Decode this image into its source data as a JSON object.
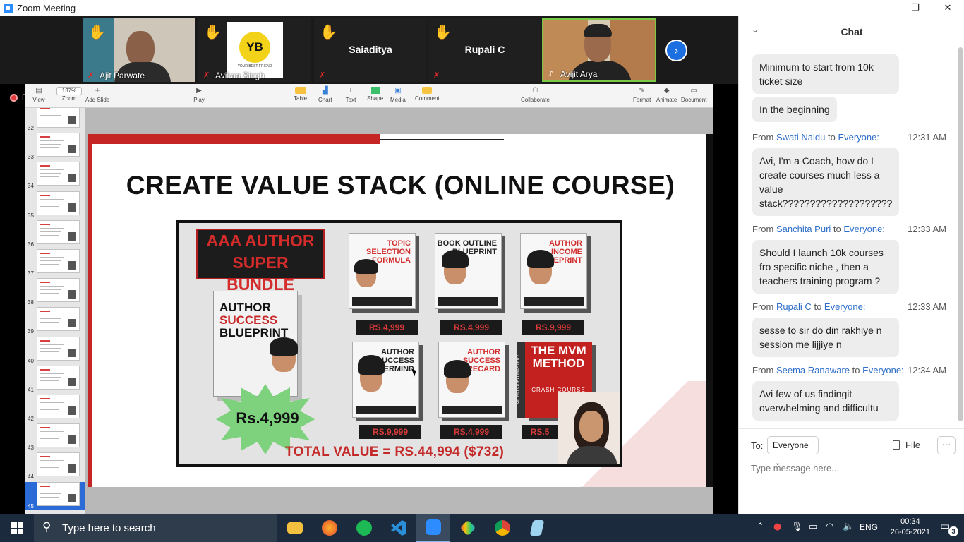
{
  "window": {
    "title": "Zoom Meeting",
    "min": "—",
    "max": "❐",
    "close": "✕"
  },
  "participants": [
    {
      "name": "Ajit Parwate"
    },
    {
      "name": "Avikaa Singh",
      "logo_text": "YB",
      "logo_caption": "YOUR BEST FRIEND"
    },
    {
      "name": "Saiaditya"
    },
    {
      "name": "Rupali C"
    },
    {
      "name": "Avijit Arya"
    }
  ],
  "share": {
    "rec_label": "R",
    "toolbar": {
      "view": "View",
      "zoom": "Zoom",
      "zoom_value": "137%",
      "add_slide": "Add Slide",
      "play": "Play",
      "table": "Table",
      "chart": "Chart",
      "text": "Text",
      "shape": "Shape",
      "media": "Media",
      "comment": "Comment",
      "collaborate": "Collaborate",
      "format": "Format",
      "animate": "Animate",
      "document": "Document"
    },
    "slides": [
      "32",
      "33",
      "34",
      "35",
      "36",
      "37",
      "38",
      "39",
      "40",
      "41",
      "42",
      "43",
      "44",
      "45"
    ],
    "slide": {
      "title": "CREATE VALUE STACK (ONLINE COURSE)",
      "bundle_line1": "AAA AUTHOR",
      "bundle_line2": "SUPER BUNDLE",
      "main_product": [
        "AUTHOR",
        "SUCCESS",
        "BLUEPRINT"
      ],
      "main_price": "Rs.4,999",
      "products": [
        {
          "title": "TOPIC SELECTION FORMULA"
        },
        {
          "title": "BOOK OUTLINE BLUEPRINT"
        },
        {
          "title": "AUTHOR INCOME BLUEPRINT"
        },
        {
          "title": "AUTHOR SUCCESS MASTERMIND"
        },
        {
          "title": "AUTHOR SUCCESS SCORECARD"
        }
      ],
      "mvm": {
        "line1": "THE MVM METHOD",
        "line2": "CRASH COURSE",
        "side": "MICRO VIDEO MASTERY"
      },
      "prices_row1": [
        "RS.4,999",
        "RS.4,999",
        "RS.9,999"
      ],
      "prices_row2": [
        "RS.9,999",
        "RS.4,999",
        "RS.5"
      ],
      "total": "TOTAL VALUE = RS.44,994 ($732)"
    }
  },
  "chat": {
    "title": "Chat",
    "messages": [
      {
        "text": "Minimum to start from 10k ticket size"
      },
      {
        "text": "In the beginning"
      },
      {
        "from_label": "From",
        "sender": "Swati Naidu",
        "to_label": "to",
        "recipient": "Everyone:",
        "time": "12:31 AM",
        "text": "Avi, I'm a Coach, how do I create courses much less a value stack????????????????????"
      },
      {
        "from_label": "From",
        "sender": "Sanchita Puri",
        "to_label": "to",
        "recipient": "Everyone:",
        "time": "12:33 AM",
        "text": "Should I launch 10k courses fro specific niche , then a teachers training program ?"
      },
      {
        "from_label": "From",
        "sender": "Rupali C",
        "to_label": "to",
        "recipient": "Everyone:",
        "time": "12:33 AM",
        "text": "sesse to sir do din rakhiye n session me lijjiye n"
      },
      {
        "from_label": "From",
        "sender": "Seema Ranaware",
        "to_label": "to",
        "recipient": "Everyone:",
        "time": "12:34 AM",
        "text": "Avi few of us findingit overwhelming and difficultu"
      }
    ],
    "to_label": "To:",
    "to_value": "Everyone",
    "file_label": "File",
    "more_label": "···",
    "input_placeholder": "Type message here..."
  },
  "taskbar": {
    "search_placeholder": "Type here to search",
    "language": "ENG",
    "time": "00:34",
    "date": "26-05-2021",
    "notifications": "3"
  }
}
